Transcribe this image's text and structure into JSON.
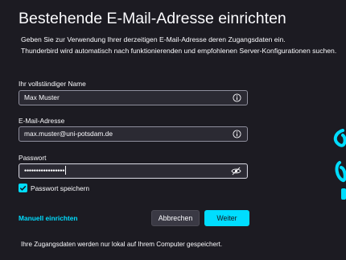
{
  "header": {
    "title": "Bestehende E-Mail-Adresse einrichten",
    "description_line1": "Geben Sie zur Verwendung Ihrer derzeitigen E-Mail-Adresse deren Zugangsdaten ein.",
    "description_line2": "Thunderbird wird automatisch nach funktionierenden und empfohlenen Server-Konfigurationen suchen."
  },
  "form": {
    "name": {
      "label": "Ihr vollständiger Name",
      "value": "Max Muster",
      "icon": "info-icon"
    },
    "email": {
      "label": "E-Mail-Adresse",
      "value": "max.muster@uni-potsdam.de",
      "icon": "info-icon"
    },
    "password": {
      "label": "Passwort",
      "value": "•••••••••••••••••",
      "icon": "eye-icon"
    },
    "remember_password": {
      "label": "Passwort speichern",
      "checked": true
    }
  },
  "actions": {
    "manual_setup": "Manuell einrichten",
    "cancel": "Abbrechen",
    "next": "Weiter"
  },
  "footer": {
    "note": "Ihre Zugangsdaten werden nur lokal auf Ihrem Computer gespeichert."
  },
  "colors": {
    "background": "#1c1b22",
    "accent": "#00ddff",
    "field_background": "#2b2a33"
  }
}
